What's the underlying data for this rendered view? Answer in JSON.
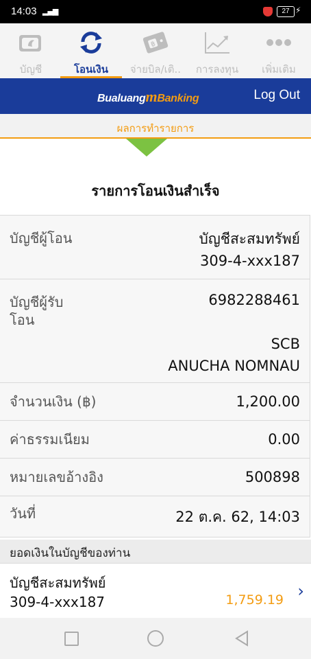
{
  "status": {
    "time": "14:03",
    "battery": "27"
  },
  "tabs": [
    {
      "label": "บัญชี",
      "icon": "wallet-icon",
      "active": false
    },
    {
      "label": "โอนเงิน",
      "icon": "transfer-icon",
      "active": true
    },
    {
      "label": "จ่ายบิล/เติ..",
      "icon": "bill-icon",
      "active": false
    },
    {
      "label": "การลงทุน",
      "icon": "chart-icon",
      "active": false
    },
    {
      "label": "เพิ่มเติม",
      "icon": "more-icon",
      "active": false
    }
  ],
  "header": {
    "brand_left": "Bualuang",
    "brand_m": "m",
    "brand_right": "Banking",
    "logout": "Log Out"
  },
  "result_label": "ผลการทำรายการ",
  "success_title": "รายการโอนเงินสำเร็จ",
  "details": {
    "from_label": "บัญชีผู้โอน",
    "from_name": "บัญชีสะสมทรัพย์",
    "from_number": "309-4-xxx187",
    "to_label": "บัญชีผู้รับโอน",
    "to_number": "6982288461",
    "to_bank": "SCB",
    "to_name": "ANUCHA NOMNAU",
    "amount_label": "จำนวนเงิน (฿)",
    "amount": "1,200.00",
    "fee_label": "ค่าธรรมเนียม",
    "fee": "0.00",
    "ref_label": "หมายเลขอ้างอิง",
    "ref": "500898",
    "date_label": "วันที่",
    "date": "22 ต.ค. 62, 14:03"
  },
  "balance": {
    "header": "ยอดเงินในบัญชีของท่าน",
    "account_name": "บัญชีสะสมทรัพย์",
    "account_number": "309-4-xxx187",
    "amount": "1,759.19"
  },
  "colors": {
    "primary": "#1a3c9a",
    "accent": "#f39c12",
    "success": "#7cc242"
  }
}
